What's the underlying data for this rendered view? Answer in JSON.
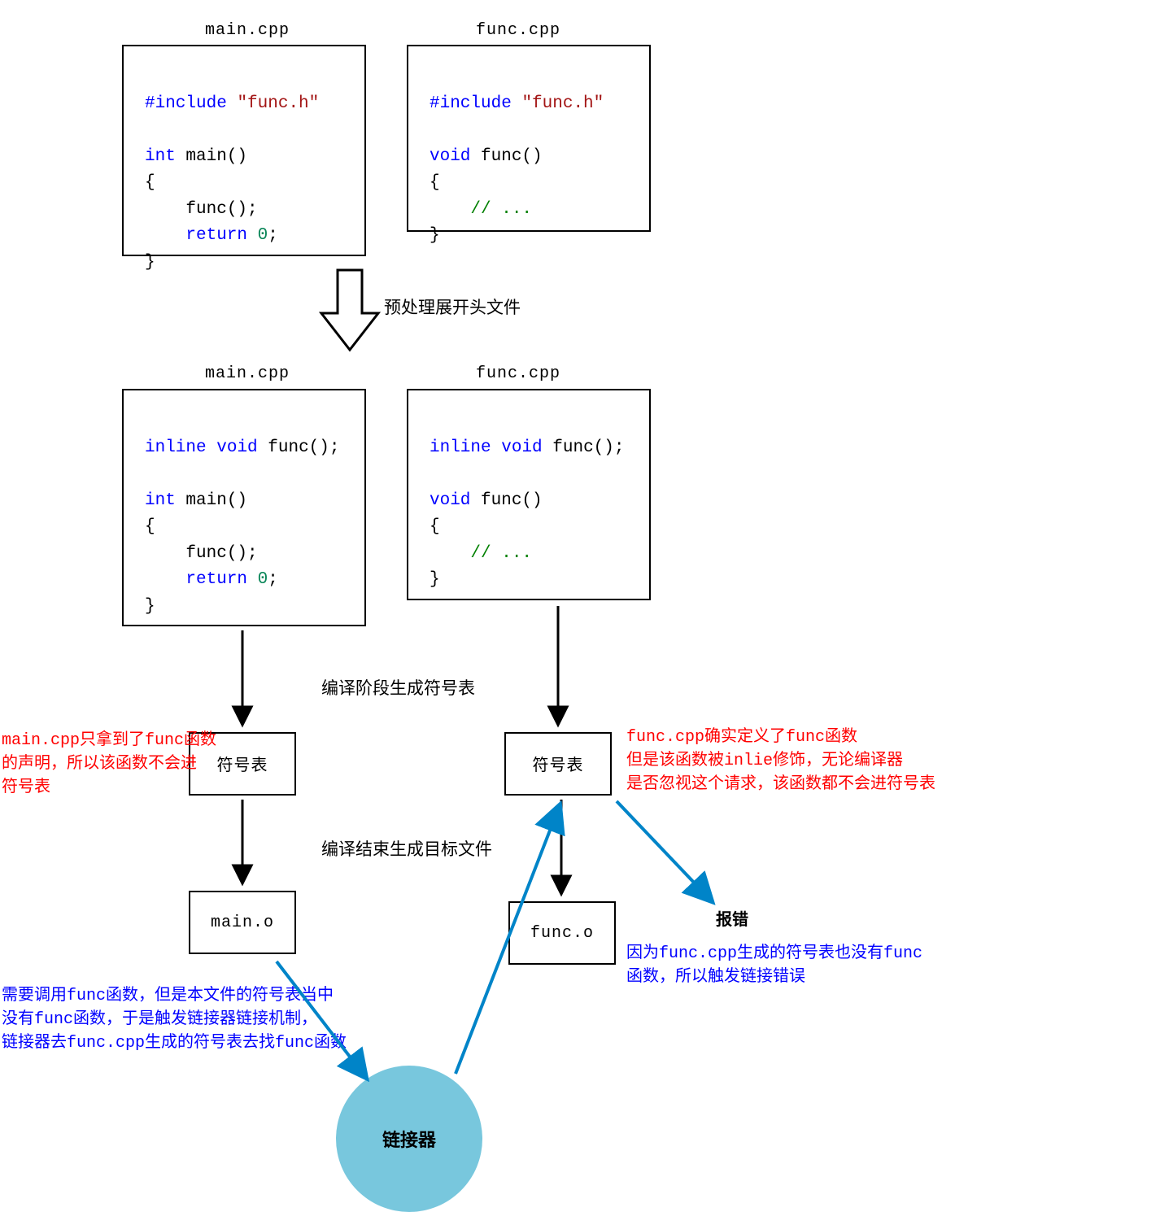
{
  "file_labels": {
    "main_cpp_top": "main.cpp",
    "func_cpp_top": "func.cpp",
    "main_cpp_mid": "main.cpp",
    "func_cpp_mid": "func.cpp"
  },
  "code": {
    "main_top": {
      "include_kw": "#include",
      "include_file": "\"func.h\"",
      "int": "int",
      "main_sig": " main()",
      "lbrace": "{",
      "call": "    func();",
      "return_kw": "return",
      "return_rest": " ",
      "zero": "0",
      "semi": ";",
      "rbrace": "}"
    },
    "func_top": {
      "include_kw": "#include",
      "include_file": "\"func.h\"",
      "void": "void",
      "func_sig": " func()",
      "lbrace": "{",
      "comment": "    // ...",
      "rbrace": "}"
    },
    "main_mid": {
      "inline": "inline",
      "void": "void",
      "decl_rest": " func();",
      "int": "int",
      "main_sig": " main()",
      "lbrace": "{",
      "call": "    func();",
      "return_kw": "return",
      "zero": "0",
      "semi": ";",
      "rbrace": "}"
    },
    "func_mid": {
      "inline": "inline",
      "void": "void",
      "decl_rest": " func();",
      "void2": "void",
      "func_sig": " func()",
      "lbrace": "{",
      "comment": "    // ...",
      "rbrace": "}"
    }
  },
  "stage_labels": {
    "preprocess": "预处理展开头文件",
    "compile": "编译阶段生成符号表",
    "compile_end": "编译结束生成目标文件"
  },
  "boxes": {
    "symtab_left": "符号表",
    "symtab_right": "符号表",
    "main_o": "main.o",
    "func_o": "func.o"
  },
  "annotations": {
    "red_left": "main.cpp只拿到了func函数\n的声明，所以该函数不会进\n符号表",
    "red_right": "func.cpp确实定义了func函数\n但是该函数被inlie修饰，无论编译器\n是否忽视这个请求，该函数都不会进符号表",
    "blue_left": "需要调用func函数，但是本文件的符号表当中\n没有func函数，于是触发链接器链接机制，\n链接器去func.cpp生成的符号表去找func函数",
    "blue_right_title": "报错",
    "blue_right_body": "因为func.cpp生成的符号表也没有func\n函数，所以触发链接错误"
  },
  "linker": "链接器"
}
